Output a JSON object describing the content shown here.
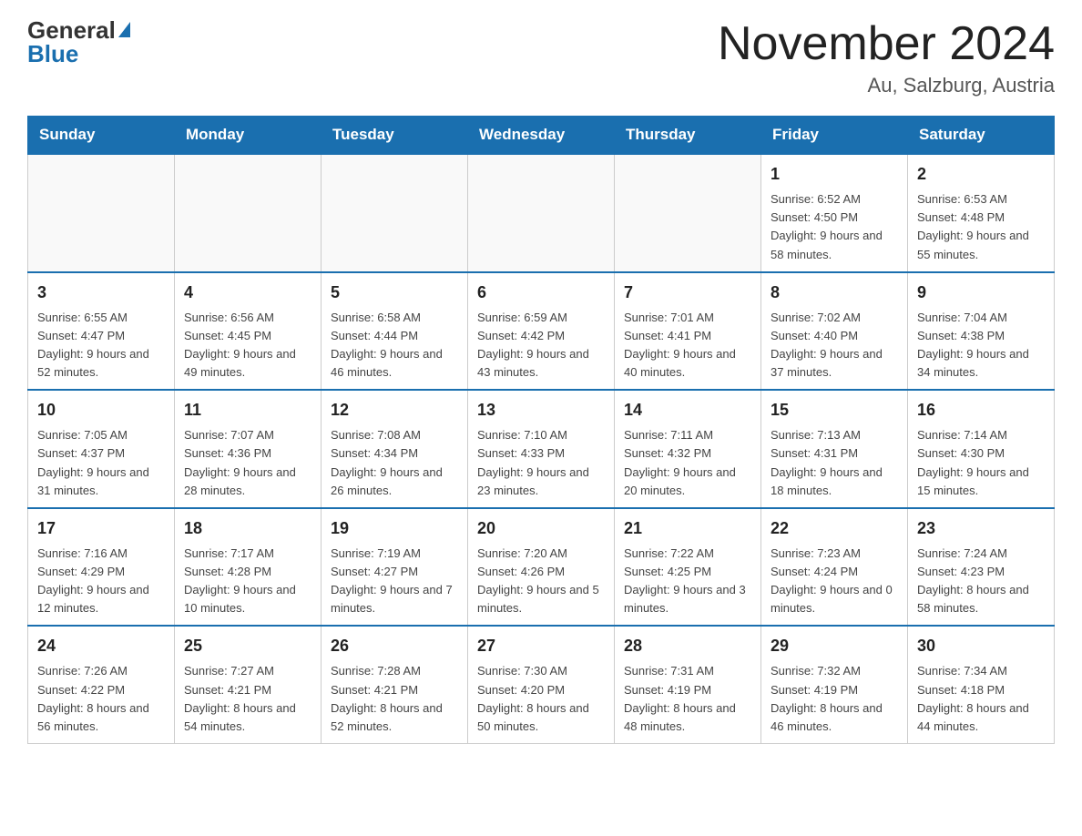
{
  "logo": {
    "general": "General",
    "blue": "Blue"
  },
  "title": "November 2024",
  "subtitle": "Au, Salzburg, Austria",
  "weekdays": [
    "Sunday",
    "Monday",
    "Tuesday",
    "Wednesday",
    "Thursday",
    "Friday",
    "Saturday"
  ],
  "weeks": [
    [
      {
        "day": "",
        "info": ""
      },
      {
        "day": "",
        "info": ""
      },
      {
        "day": "",
        "info": ""
      },
      {
        "day": "",
        "info": ""
      },
      {
        "day": "",
        "info": ""
      },
      {
        "day": "1",
        "info": "Sunrise: 6:52 AM\nSunset: 4:50 PM\nDaylight: 9 hours and 58 minutes."
      },
      {
        "day": "2",
        "info": "Sunrise: 6:53 AM\nSunset: 4:48 PM\nDaylight: 9 hours and 55 minutes."
      }
    ],
    [
      {
        "day": "3",
        "info": "Sunrise: 6:55 AM\nSunset: 4:47 PM\nDaylight: 9 hours and 52 minutes."
      },
      {
        "day": "4",
        "info": "Sunrise: 6:56 AM\nSunset: 4:45 PM\nDaylight: 9 hours and 49 minutes."
      },
      {
        "day": "5",
        "info": "Sunrise: 6:58 AM\nSunset: 4:44 PM\nDaylight: 9 hours and 46 minutes."
      },
      {
        "day": "6",
        "info": "Sunrise: 6:59 AM\nSunset: 4:42 PM\nDaylight: 9 hours and 43 minutes."
      },
      {
        "day": "7",
        "info": "Sunrise: 7:01 AM\nSunset: 4:41 PM\nDaylight: 9 hours and 40 minutes."
      },
      {
        "day": "8",
        "info": "Sunrise: 7:02 AM\nSunset: 4:40 PM\nDaylight: 9 hours and 37 minutes."
      },
      {
        "day": "9",
        "info": "Sunrise: 7:04 AM\nSunset: 4:38 PM\nDaylight: 9 hours and 34 minutes."
      }
    ],
    [
      {
        "day": "10",
        "info": "Sunrise: 7:05 AM\nSunset: 4:37 PM\nDaylight: 9 hours and 31 minutes."
      },
      {
        "day": "11",
        "info": "Sunrise: 7:07 AM\nSunset: 4:36 PM\nDaylight: 9 hours and 28 minutes."
      },
      {
        "day": "12",
        "info": "Sunrise: 7:08 AM\nSunset: 4:34 PM\nDaylight: 9 hours and 26 minutes."
      },
      {
        "day": "13",
        "info": "Sunrise: 7:10 AM\nSunset: 4:33 PM\nDaylight: 9 hours and 23 minutes."
      },
      {
        "day": "14",
        "info": "Sunrise: 7:11 AM\nSunset: 4:32 PM\nDaylight: 9 hours and 20 minutes."
      },
      {
        "day": "15",
        "info": "Sunrise: 7:13 AM\nSunset: 4:31 PM\nDaylight: 9 hours and 18 minutes."
      },
      {
        "day": "16",
        "info": "Sunrise: 7:14 AM\nSunset: 4:30 PM\nDaylight: 9 hours and 15 minutes."
      }
    ],
    [
      {
        "day": "17",
        "info": "Sunrise: 7:16 AM\nSunset: 4:29 PM\nDaylight: 9 hours and 12 minutes."
      },
      {
        "day": "18",
        "info": "Sunrise: 7:17 AM\nSunset: 4:28 PM\nDaylight: 9 hours and 10 minutes."
      },
      {
        "day": "19",
        "info": "Sunrise: 7:19 AM\nSunset: 4:27 PM\nDaylight: 9 hours and 7 minutes."
      },
      {
        "day": "20",
        "info": "Sunrise: 7:20 AM\nSunset: 4:26 PM\nDaylight: 9 hours and 5 minutes."
      },
      {
        "day": "21",
        "info": "Sunrise: 7:22 AM\nSunset: 4:25 PM\nDaylight: 9 hours and 3 minutes."
      },
      {
        "day": "22",
        "info": "Sunrise: 7:23 AM\nSunset: 4:24 PM\nDaylight: 9 hours and 0 minutes."
      },
      {
        "day": "23",
        "info": "Sunrise: 7:24 AM\nSunset: 4:23 PM\nDaylight: 8 hours and 58 minutes."
      }
    ],
    [
      {
        "day": "24",
        "info": "Sunrise: 7:26 AM\nSunset: 4:22 PM\nDaylight: 8 hours and 56 minutes."
      },
      {
        "day": "25",
        "info": "Sunrise: 7:27 AM\nSunset: 4:21 PM\nDaylight: 8 hours and 54 minutes."
      },
      {
        "day": "26",
        "info": "Sunrise: 7:28 AM\nSunset: 4:21 PM\nDaylight: 8 hours and 52 minutes."
      },
      {
        "day": "27",
        "info": "Sunrise: 7:30 AM\nSunset: 4:20 PM\nDaylight: 8 hours and 50 minutes."
      },
      {
        "day": "28",
        "info": "Sunrise: 7:31 AM\nSunset: 4:19 PM\nDaylight: 8 hours and 48 minutes."
      },
      {
        "day": "29",
        "info": "Sunrise: 7:32 AM\nSunset: 4:19 PM\nDaylight: 8 hours and 46 minutes."
      },
      {
        "day": "30",
        "info": "Sunrise: 7:34 AM\nSunset: 4:18 PM\nDaylight: 8 hours and 44 minutes."
      }
    ]
  ]
}
